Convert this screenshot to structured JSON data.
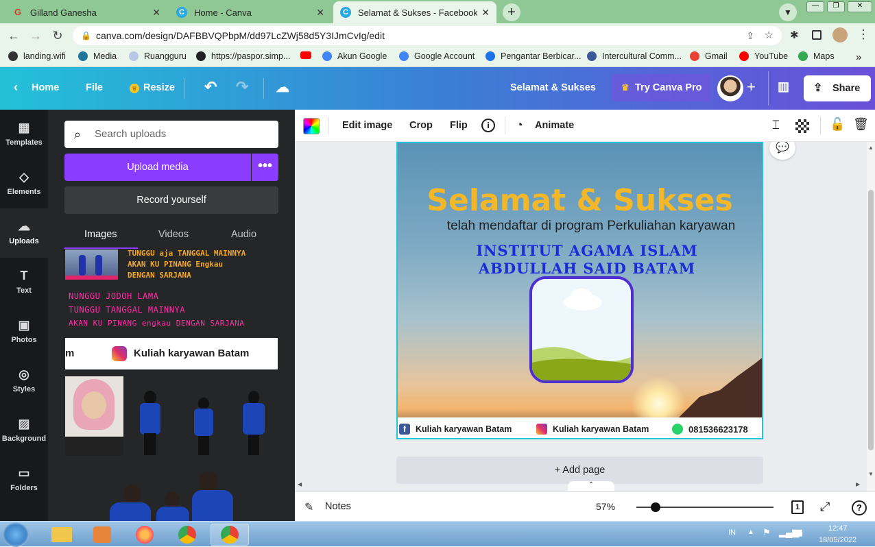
{
  "browser": {
    "tabs": [
      {
        "title": "Gilland Ganesha",
        "favicon_color": "#d33b2f"
      },
      {
        "title": "Home - Canva",
        "favicon_color": "#2aa8e0"
      },
      {
        "title": "Selamat & Sukses - Facebook Po",
        "favicon_color": "#2aa8e0"
      }
    ],
    "url": "canva.com/design/DAFBBVQPbpM/dd97LcZWj58d5Y3IJmCvIg/edit",
    "bookmarks": [
      {
        "label": "landing.wifi",
        "color": "#333"
      },
      {
        "label": "Media",
        "color": "#21759b"
      },
      {
        "label": "Ruangguru",
        "color": "#b9c7e6"
      },
      {
        "label": "https://paspor.simp...",
        "color": "#222"
      },
      {
        "label": "",
        "color": "#ff0000"
      },
      {
        "label": "Akun Google",
        "color": "#4285f4"
      },
      {
        "label": "Google Account",
        "color": "#4285f4"
      },
      {
        "label": "Pengantar Berbicar...",
        "color": "#1a73e8"
      },
      {
        "label": "Intercultural Comm...",
        "color": "#3b5998"
      },
      {
        "label": "Gmail",
        "color": "#ea4335"
      },
      {
        "label": "YouTube",
        "color": "#ff0000"
      },
      {
        "label": "Maps",
        "color": "#34a853"
      }
    ],
    "more_bookmarks": "»"
  },
  "header": {
    "home": "Home",
    "file": "File",
    "resize": "Resize",
    "design_title": "Selamat & Sukses",
    "try_pro": "Try Canva Pro",
    "share": "Share"
  },
  "sidenav": [
    {
      "label": "Templates",
      "icon": "▦"
    },
    {
      "label": "Elements",
      "icon": "◇"
    },
    {
      "label": "Uploads",
      "icon": "☁"
    },
    {
      "label": "Text",
      "icon": "T"
    },
    {
      "label": "Photos",
      "icon": "▣"
    },
    {
      "label": "Styles",
      "icon": "◎"
    },
    {
      "label": "Background",
      "icon": "▨"
    },
    {
      "label": "Folders",
      "icon": "▭"
    }
  ],
  "panel": {
    "search_placeholder": "Search uploads",
    "upload_btn": "Upload media",
    "more_btn": "•••",
    "record_btn": "Record yourself",
    "tabs": [
      "Images",
      "Videos",
      "Audio"
    ],
    "thumb1_lines": [
      "TUNGGU aja TANGGAL MAINNYA",
      "AKAN KU PINANG Engkau",
      "DENGAN SARJANA"
    ],
    "thumb2_lines": [
      "NUNGGU JODOH LAMA",
      "TUNGGU TANGGAL MAINNYA",
      "AKAN KU PINANG engkau DENGAN SARJANA"
    ],
    "thumb3_left": "m",
    "thumb3_text": "Kuliah karyawan Batam"
  },
  "toolbar": {
    "edit_image": "Edit image",
    "crop": "Crop",
    "flip": "Flip",
    "animate": "Animate"
  },
  "design": {
    "title": "Selamat & Sukses",
    "subtitle": "telah mendaftar di program Perkuliahan karyawan",
    "institute_line1": "INSTITUT AGAMA ISLAM",
    "institute_line2": "ABDULLAH SAID BATAM",
    "footer_facebook": "Kuliah karyawan Batam",
    "footer_instagram": "Kuliah karyawan Batam",
    "footer_whatsapp": "081536623178"
  },
  "workspace": {
    "add_page": "+ Add page"
  },
  "bottombar": {
    "notes": "Notes",
    "zoom": "57%",
    "zoom_level": 0.57,
    "page_number": "1"
  },
  "taskbar": {
    "lang": "IN",
    "time": "12:47",
    "date": "18/05/2022"
  }
}
